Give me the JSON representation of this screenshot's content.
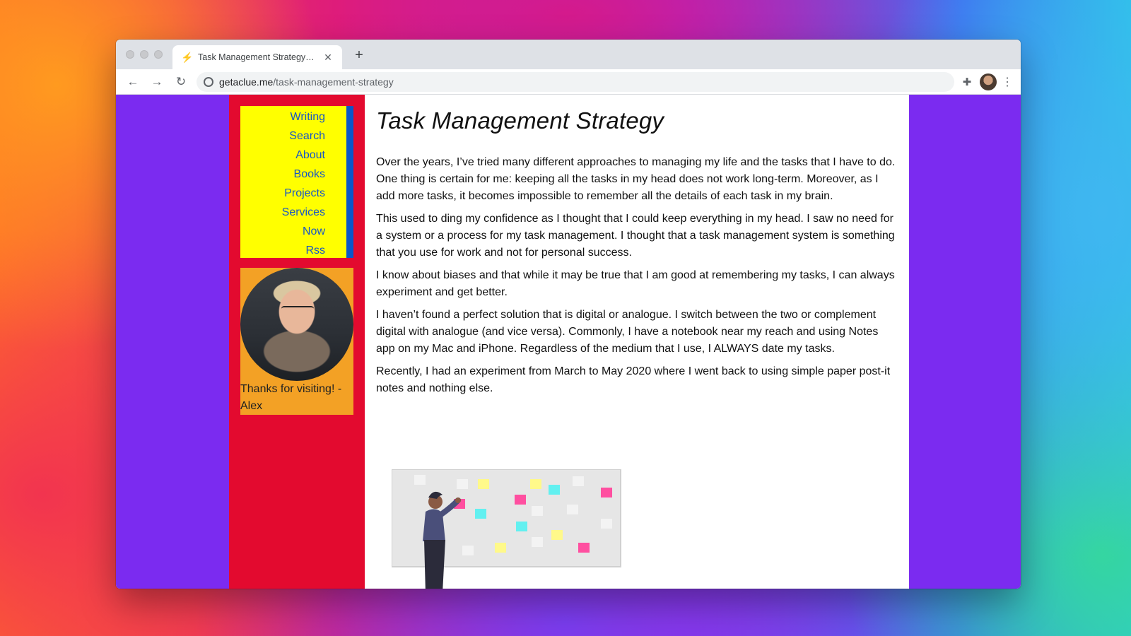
{
  "browser": {
    "tab_title": "Task Management Strategy - A",
    "tab_favicon": "⚡",
    "close_glyph": "✕",
    "new_tab_glyph": "+",
    "url_host": "getaclue.me",
    "url_path": "/task-management-strategy",
    "back_glyph": "←",
    "forward_glyph": "→",
    "reload_glyph": "↻",
    "extensions_glyph": "✚",
    "menu_glyph": "⋮"
  },
  "nav": {
    "items": [
      {
        "label": "Writing"
      },
      {
        "label": "Search"
      },
      {
        "label": "About"
      },
      {
        "label": "Books"
      },
      {
        "label": "Projects"
      },
      {
        "label": "Services"
      },
      {
        "label": "Now"
      },
      {
        "label": "Rss"
      }
    ]
  },
  "profile": {
    "caption": "Thanks for visiting! - Alex"
  },
  "article": {
    "title": "Task Management Strategy",
    "paragraphs": [
      "Over the years, I’ve tried many different approaches to managing my life and the tasks that I have to do. One thing is certain for me: keeping all the tasks in my head does not work long-term. Moreover, as I add more tasks, it becomes impossible to remember all the details of each task in my brain.",
      "This used to ding my confidence as I thought that I could keep everything in my head. I saw no need for a system or a process for my task management. I thought that a task management system is something that you use for work and not for personal success.",
      "I know about biases and that while it may be true that I am good at remembering my tasks, I can always experiment and get better.",
      "I haven’t found a perfect solution that is digital or analogue. I switch between the two or complement digital with analogue (and vice versa). Commonly, I have a notebook near my reach and using Notes app on my Mac and iPhone. Regardless of the medium that I use, I ALWAYS date my tasks.",
      "Recently, I had an experiment from March to May 2020 where I went back to using simple paper post-it notes and nothing else."
    ]
  },
  "colors": {
    "page_bg": "#7b2bf0",
    "sidebar_bg": "#e30a2f",
    "nav_bg": "#ffff00",
    "nav_border": "#0a56c9",
    "nav_link": "#1756c7",
    "profile_bg": "#f3a125"
  }
}
